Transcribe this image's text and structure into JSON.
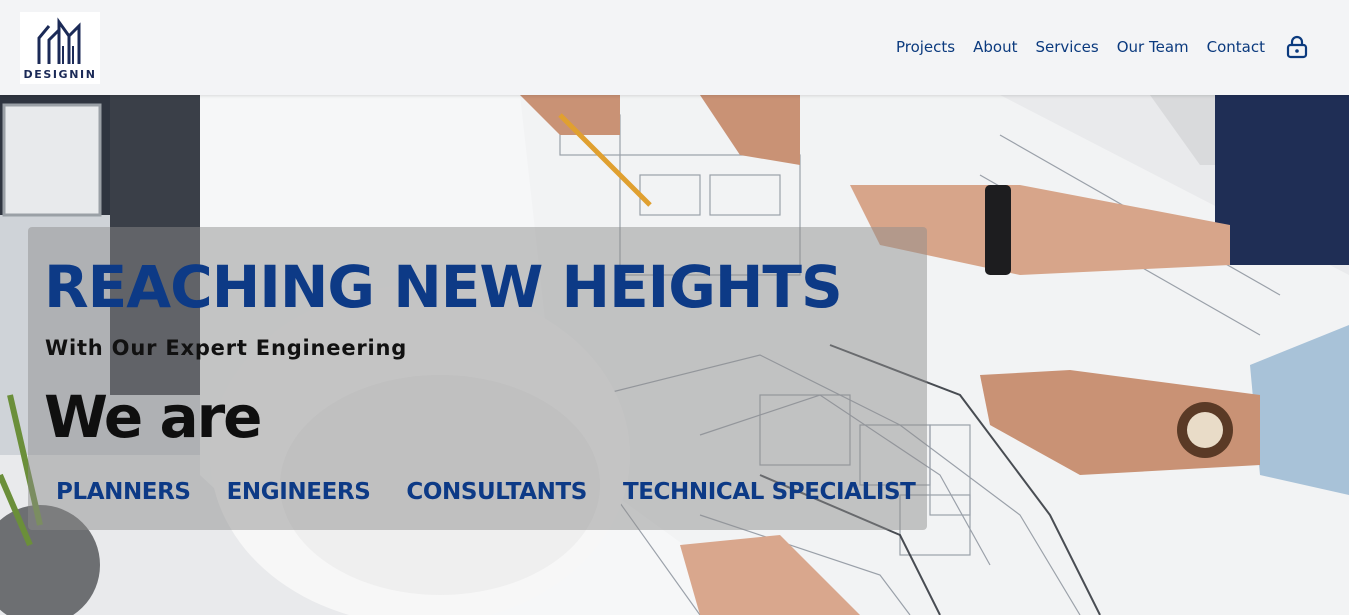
{
  "brand": {
    "logo_text": "DESIGNIN",
    "logo_icon": "building-skyline-icon",
    "colors": {
      "primary": "#0d3a86",
      "nav": "#0b3a7e",
      "logo": "#1b2a57"
    }
  },
  "nav": {
    "items": [
      {
        "label": "Projects"
      },
      {
        "label": "About"
      },
      {
        "label": "Services"
      },
      {
        "label": "Our Team"
      },
      {
        "label": "Contact"
      }
    ],
    "lock_icon": "lock-icon"
  },
  "hero": {
    "headline": "REACHING NEW HEIGHTS",
    "subheadline": "With Our Expert Engineering",
    "we_are": "We are",
    "roles": [
      "PLANNERS",
      "ENGINEERS",
      "CONSULTANTS",
      "TECHNICAL SPECIALIST"
    ],
    "background": "blueprint-photo"
  }
}
